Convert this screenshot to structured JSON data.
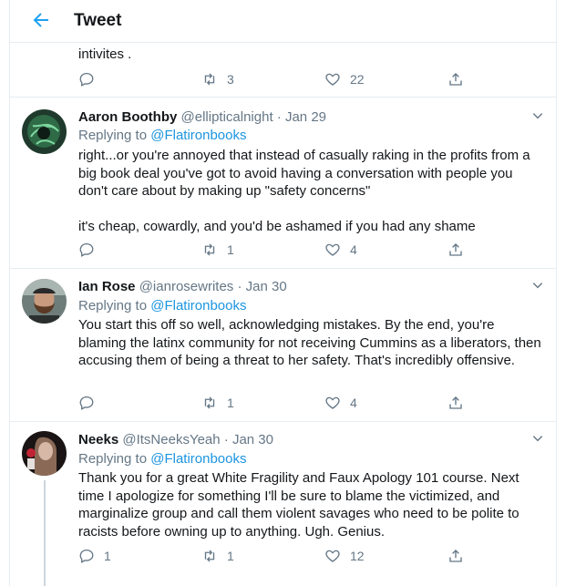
{
  "header": {
    "title": "Tweet"
  },
  "top_tweet": {
    "text": "intivites .",
    "retweets": "3",
    "likes": "22"
  },
  "replies": [
    {
      "name": "Aaron Boothby",
      "handle": "@ellipticalnight",
      "sep": "·",
      "date": "Jan 29",
      "replying_label": "Replying to",
      "replying_to": "@Flatironbooks",
      "text": "right...or you're annoyed that instead of casually raking in the profits from a big book deal you've got to avoid having a conversation with people you don't care about by making up \"safety concerns\"\n\nit's cheap, cowardly, and you'd be ashamed if you had any shame",
      "replies_count": "",
      "retweets": "1",
      "likes": "4"
    },
    {
      "name": "Ian Rose",
      "handle": "@ianrosewrites",
      "sep": "·",
      "date": "Jan 30",
      "replying_label": "Replying to",
      "replying_to": "@Flatironbooks",
      "text": "You start this off so well, acknowledging mistakes. By the end, you're blaming the latinx community for not receiving Cummins as a liberators, then accusing them of being a threat to her safety. That's incredibly offensive.",
      "replies_count": "",
      "retweets": "1",
      "likes": "4"
    },
    {
      "name": "Neeks",
      "handle": "@ItsNeeksYeah",
      "sep": "·",
      "date": "Jan 30",
      "replying_label": "Replying to",
      "replying_to": "@Flatironbooks",
      "text": "Thank you for a great White Fragility and Faux Apology 101 course. Next time I apologize for something I'll be sure to blame the victimized, and marginalize group and call them violent savages who need to be polite to racists before owning up to anything. Ugh. Genius.",
      "replies_count": "1",
      "retweets": "1",
      "likes": "12"
    }
  ],
  "colors": {
    "accent": "#1da1f2",
    "link": "#1b95e0",
    "muted": "#657786",
    "border": "#e6ecf0"
  },
  "icons": [
    "back-arrow-icon",
    "reply-icon",
    "retweet-icon",
    "like-icon",
    "share-icon",
    "chevron-down-icon"
  ]
}
